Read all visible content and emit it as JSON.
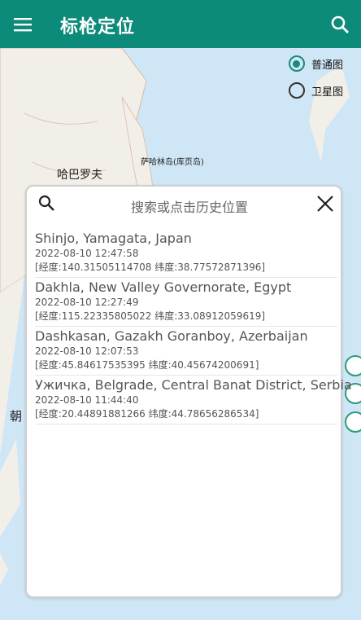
{
  "app": {
    "title": "标枪定位"
  },
  "map": {
    "options": [
      {
        "label": "普通图",
        "selected": true
      },
      {
        "label": "卫星图",
        "selected": false
      }
    ],
    "labels": {
      "sakhalin": "萨哈林岛(库页岛)",
      "khabarovsk": "哈巴罗夫",
      "korea": "朝"
    }
  },
  "dialog": {
    "placeholder": "搜索或点击历史位置",
    "history": [
      {
        "name": "Shinjo, Yamagata, Japan",
        "time": "2022-08-10 12:47:58",
        "coord": "[经度:140.31505114708 纬度:38.77572871396]"
      },
      {
        "name": "Dakhla, New Valley Governorate, Egypt",
        "time": "2022-08-10 12:27:49",
        "coord": "[经度:115.22335805022 纬度:33.08912059619]"
      },
      {
        "name": "Dashkasan, Gazakh Goranboy, Azerbaijan",
        "time": "2022-08-10 12:07:53",
        "coord": "[经度:45.84617535395 纬度:40.45674200691]"
      },
      {
        "name": "Ужичка, Belgrade, Central Banat District, Serbia",
        "time": "2022-08-10 11:44:40",
        "coord": "[经度:20.44891881266 纬度:44.78656286534]"
      }
    ]
  }
}
